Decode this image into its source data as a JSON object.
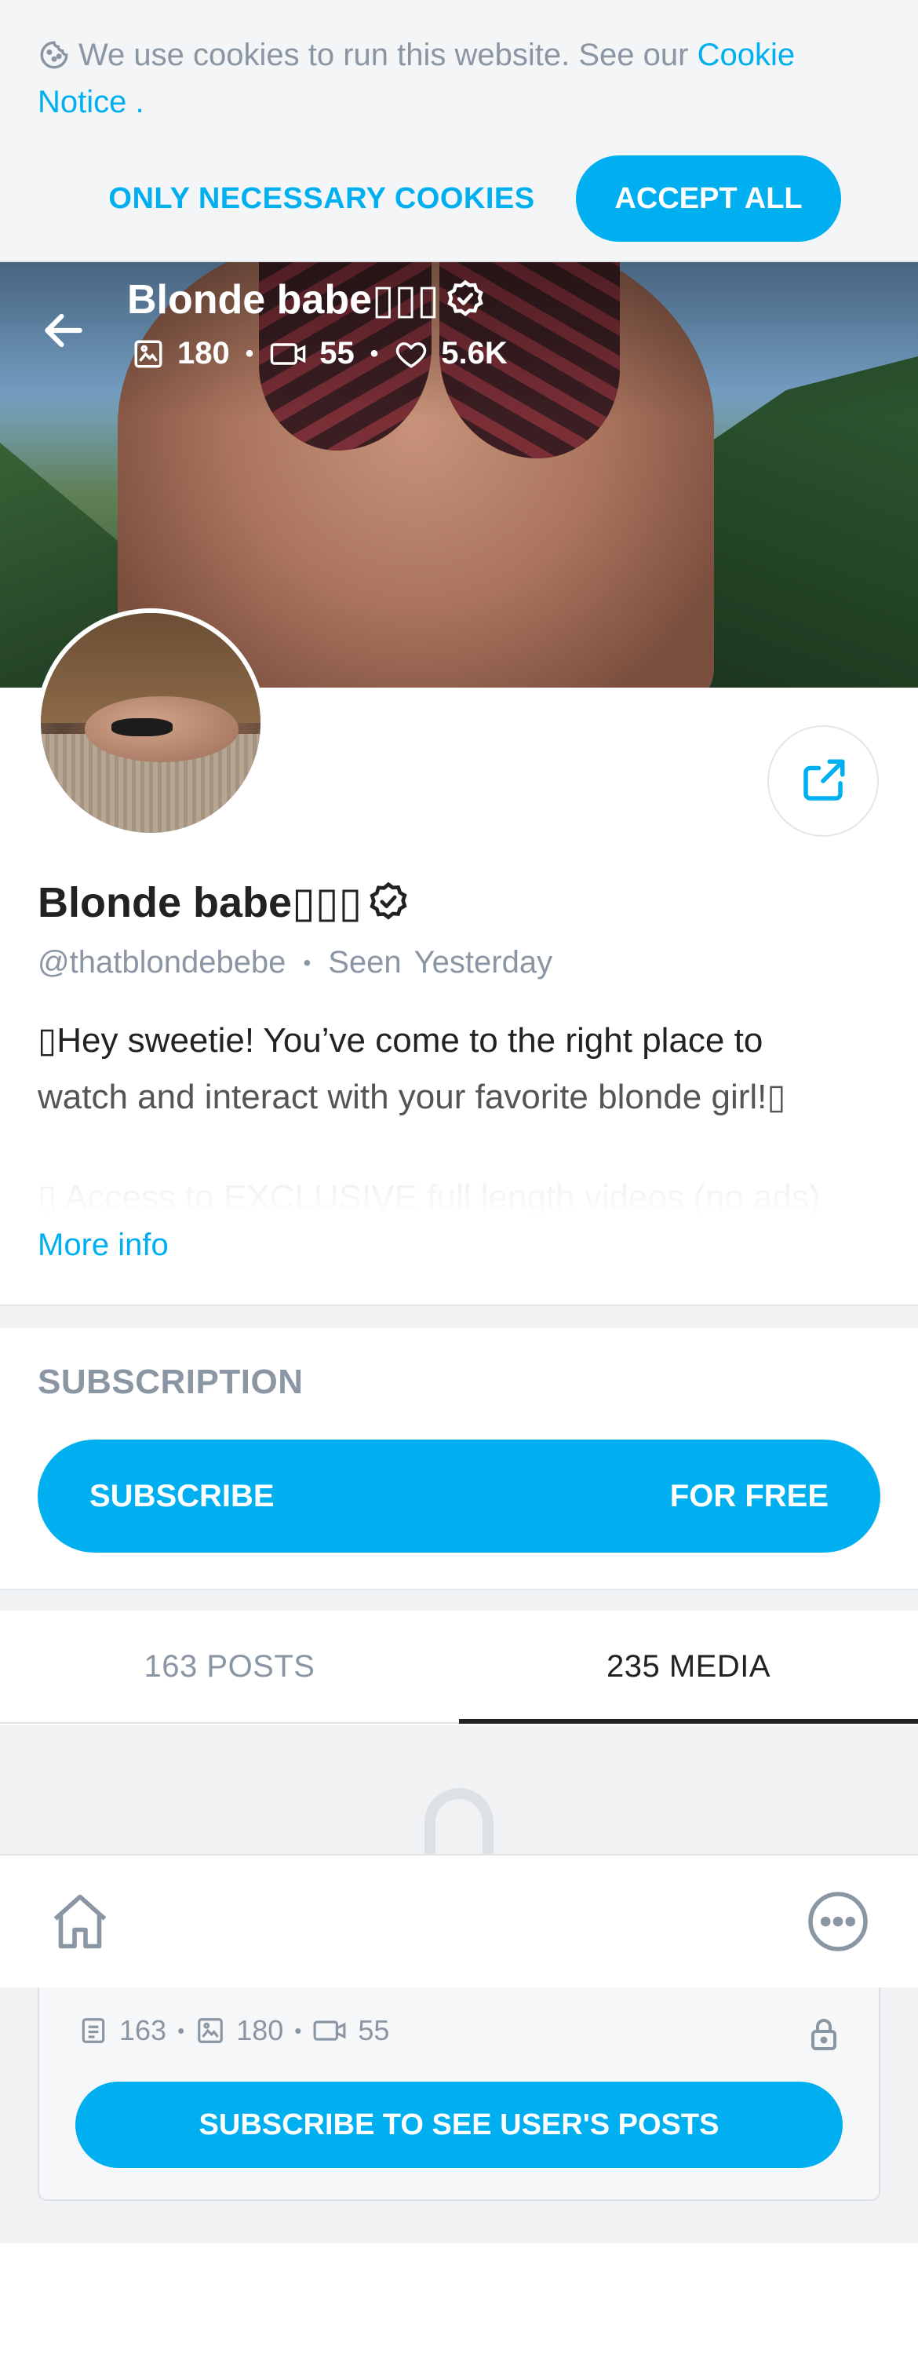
{
  "colors": {
    "accent": "#00aff0",
    "muted": "#8a96a3",
    "text": "#222222"
  },
  "cookie": {
    "icon": "cookie-icon",
    "text": "We use cookies to run this website. See our ",
    "link": "Cookie Notice",
    "trail": " .",
    "necessary_button": "ONLY NECESSARY COOKIES",
    "accept_button": "ACCEPT ALL"
  },
  "header": {
    "name": "Blonde babe▯▯▯",
    "photos": "180",
    "videos": "55",
    "likes": "5.6K",
    "icons": [
      "back-arrow-icon",
      "verified-icon",
      "image-icon",
      "video-icon",
      "heart-icon"
    ]
  },
  "profile": {
    "name": "Blonde babe▯▯▯",
    "username": "@thatblondebebe",
    "seen_label": "Seen",
    "seen_value": "Yesterday",
    "bio_line1": "▯Hey sweetie! You’ve come to the right place to",
    "bio_line2": "watch and interact with your favorite blonde girl!▯",
    "bio_faded": "▯ Access to EXCLUSIVE full length videos (no ads)",
    "more_info": "More info",
    "share_icon": "share-icon"
  },
  "subscription": {
    "title": "SUBSCRIPTION",
    "button_label": "SUBSCRIBE",
    "price": "FOR FREE"
  },
  "tabs": [
    {
      "label": "163 POSTS",
      "active": false
    },
    {
      "label": "235 MEDIA",
      "active": true
    }
  ],
  "bottom_nav": {
    "icons": [
      "home-icon",
      "more-icon"
    ]
  },
  "locked": {
    "posts": "163",
    "photos": "180",
    "videos": "55",
    "button": "SUBSCRIBE TO SEE USER'S POSTS",
    "icons": [
      "lock-icon",
      "post-icon",
      "image-icon",
      "video-icon"
    ]
  }
}
